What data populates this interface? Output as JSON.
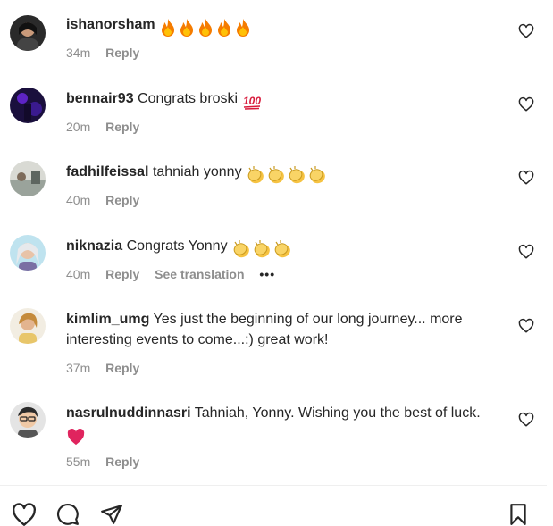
{
  "comments": [
    {
      "username": "ishanorsham",
      "text": "",
      "time": "34m",
      "reply": "Reply",
      "emoji": "fire-emoji",
      "emoji_count": 5
    },
    {
      "username": "bennair93",
      "text": "Congrats broski",
      "time": "20m",
      "reply": "Reply",
      "emoji": "hundred-points-emoji",
      "emoji_count": 1
    },
    {
      "username": "fadhilfeissal",
      "text": "tahniah yonny",
      "time": "40m",
      "reply": "Reply",
      "emoji": "clapping-hands-emoji",
      "emoji_count": 4
    },
    {
      "username": "niknazia",
      "text": "Congrats Yonny",
      "time": "40m",
      "reply": "Reply",
      "translate": "See translation",
      "more": "•••",
      "emoji": "clapping-hands-emoji",
      "emoji_count": 3
    },
    {
      "username": "kimlim_umg",
      "text": "Yes just the beginning of our long journey... more interesting events to come...:) great work!",
      "time": "37m",
      "reply": "Reply"
    },
    {
      "username": "nasrulnuddinnasri",
      "text": "Tahniah, Yonny. Wishing you the best of luck.",
      "time": "55m",
      "reply": "Reply",
      "emoji": "red-heart-emoji",
      "emoji_count": 1
    }
  ],
  "icons": {
    "like": "heart-outline-icon",
    "action_bar": [
      "heart-outline-icon",
      "comment-bubble-icon",
      "send-paper-plane-icon",
      "bookmark-icon"
    ]
  },
  "colors": {
    "text": "#262626",
    "muted": "#8e8e8e",
    "fire": "#f57c00",
    "clap": "#f6c342",
    "heart": "#e0245e",
    "hundred": "#d81b3c"
  }
}
